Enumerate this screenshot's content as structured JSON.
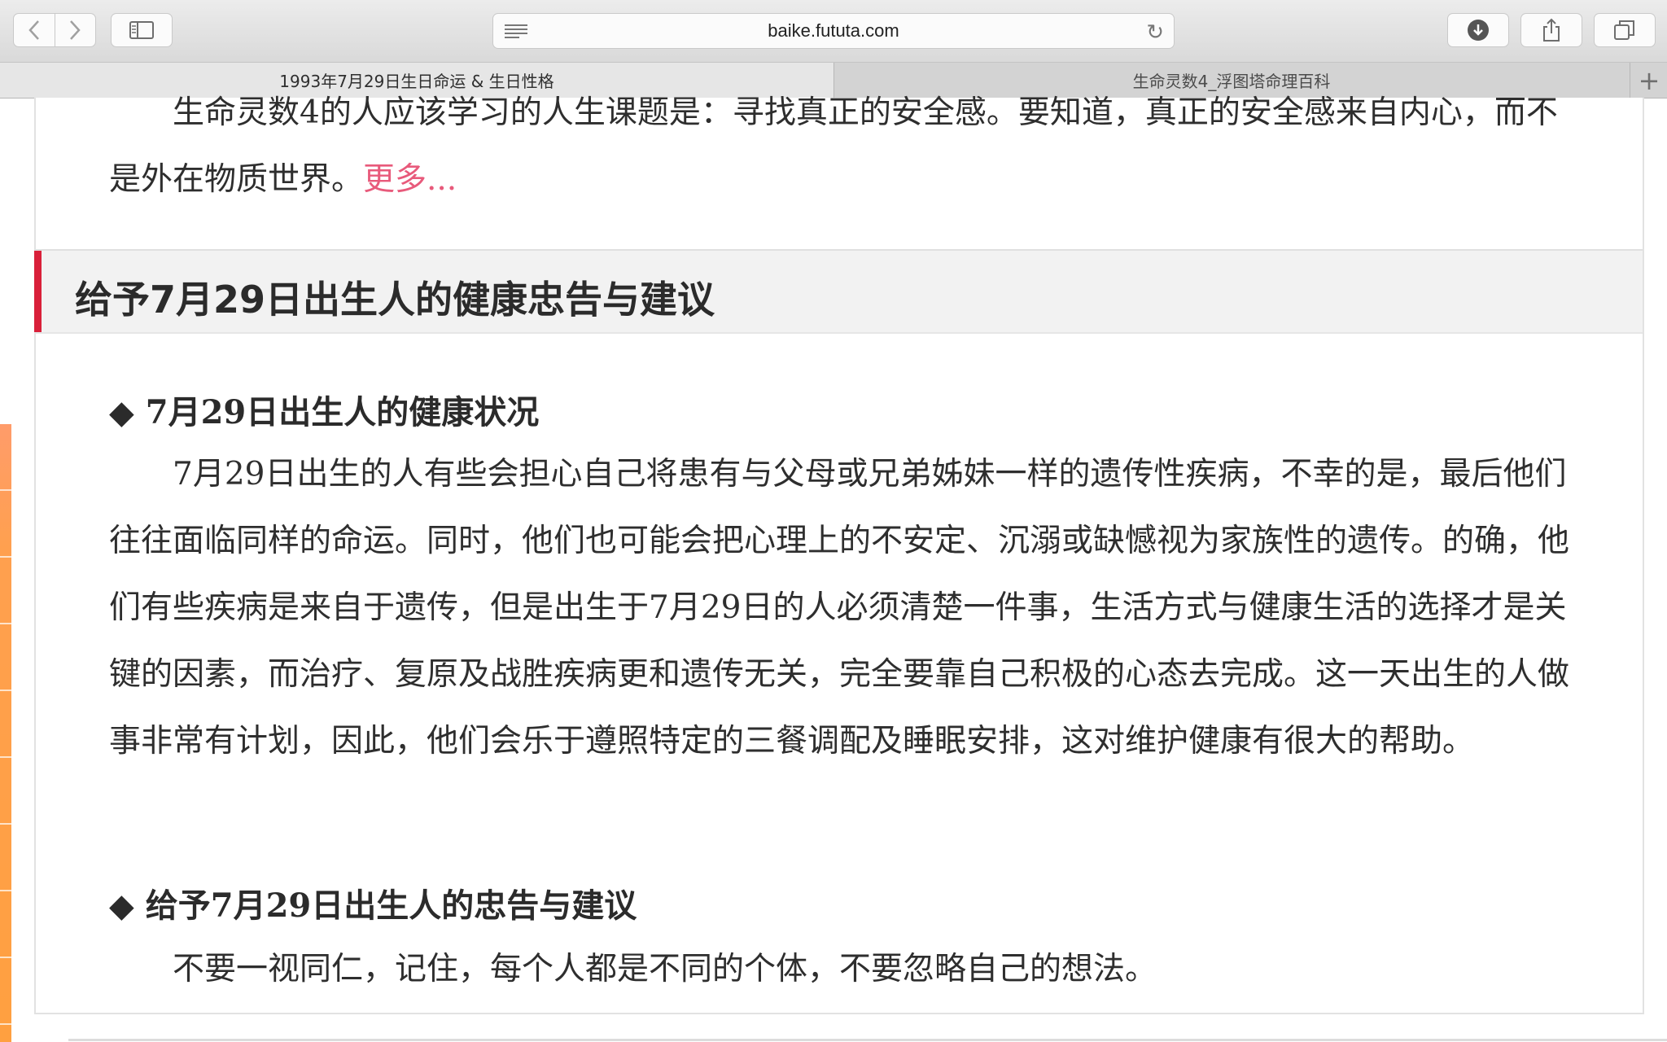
{
  "browser": {
    "url": "baike.fututa.com",
    "tabs": [
      {
        "label": "1993年7月29日生日命运 & 生日性格",
        "active": true
      },
      {
        "label": "生命灵数4_浮图塔命理百科",
        "active": false
      }
    ],
    "new_tab": "+",
    "icons": {
      "back": "chevron-left-icon",
      "forward": "chevron-right-icon",
      "sidebar": "sidebar-icon",
      "reader": "reader-icon",
      "reload": "reload-icon",
      "download": "download-icon",
      "share": "share-icon",
      "tabs": "tabs-overview-icon"
    }
  },
  "article": {
    "intro_text": "生命灵数4的人应该学习的人生课题是：寻找真正的安全感。要知道，真正的安全感来自内心，而不是外在物质世界。",
    "more_link": "更多...",
    "section_title": "给予7月29日出生人的健康忠告与建议",
    "sub1_marker": "◆",
    "sub1_title": "7月29日出生人的健康状况",
    "sub1_text": "7月29日出生的人有些会担心自己将患有与父母或兄弟姊妹一样的遗传性疾病，不幸的是，最后他们往往面临同样的命运。同时，他们也可能会把心理上的不安定、沉溺或缺憾视为家族性的遗传。的确，他们有些疾病是来自于遗传，但是出生于7月29日的人必须清楚一件事，生活方式与健康生活的选择才是关键的因素，而治疗、复原及战胜疾病更和遗传无关，完全要靠自己积极的心态去完成。这一天出生的人做事非常有计划，因此，他们会乐于遵照特定的三餐调配及睡眠安排，这对维护健康有很大的帮助。",
    "sub2_marker": "◆",
    "sub2_title": "给予7月29日出生人的忠告与建议",
    "sub2_text": "不要一视同仁，记住，每个人都是不同的个体，不要忽略自己的想法。"
  },
  "colors": {
    "accent_red": "#d9203a",
    "more_link": "#e85a7b",
    "side_strip": "#ffa040"
  }
}
